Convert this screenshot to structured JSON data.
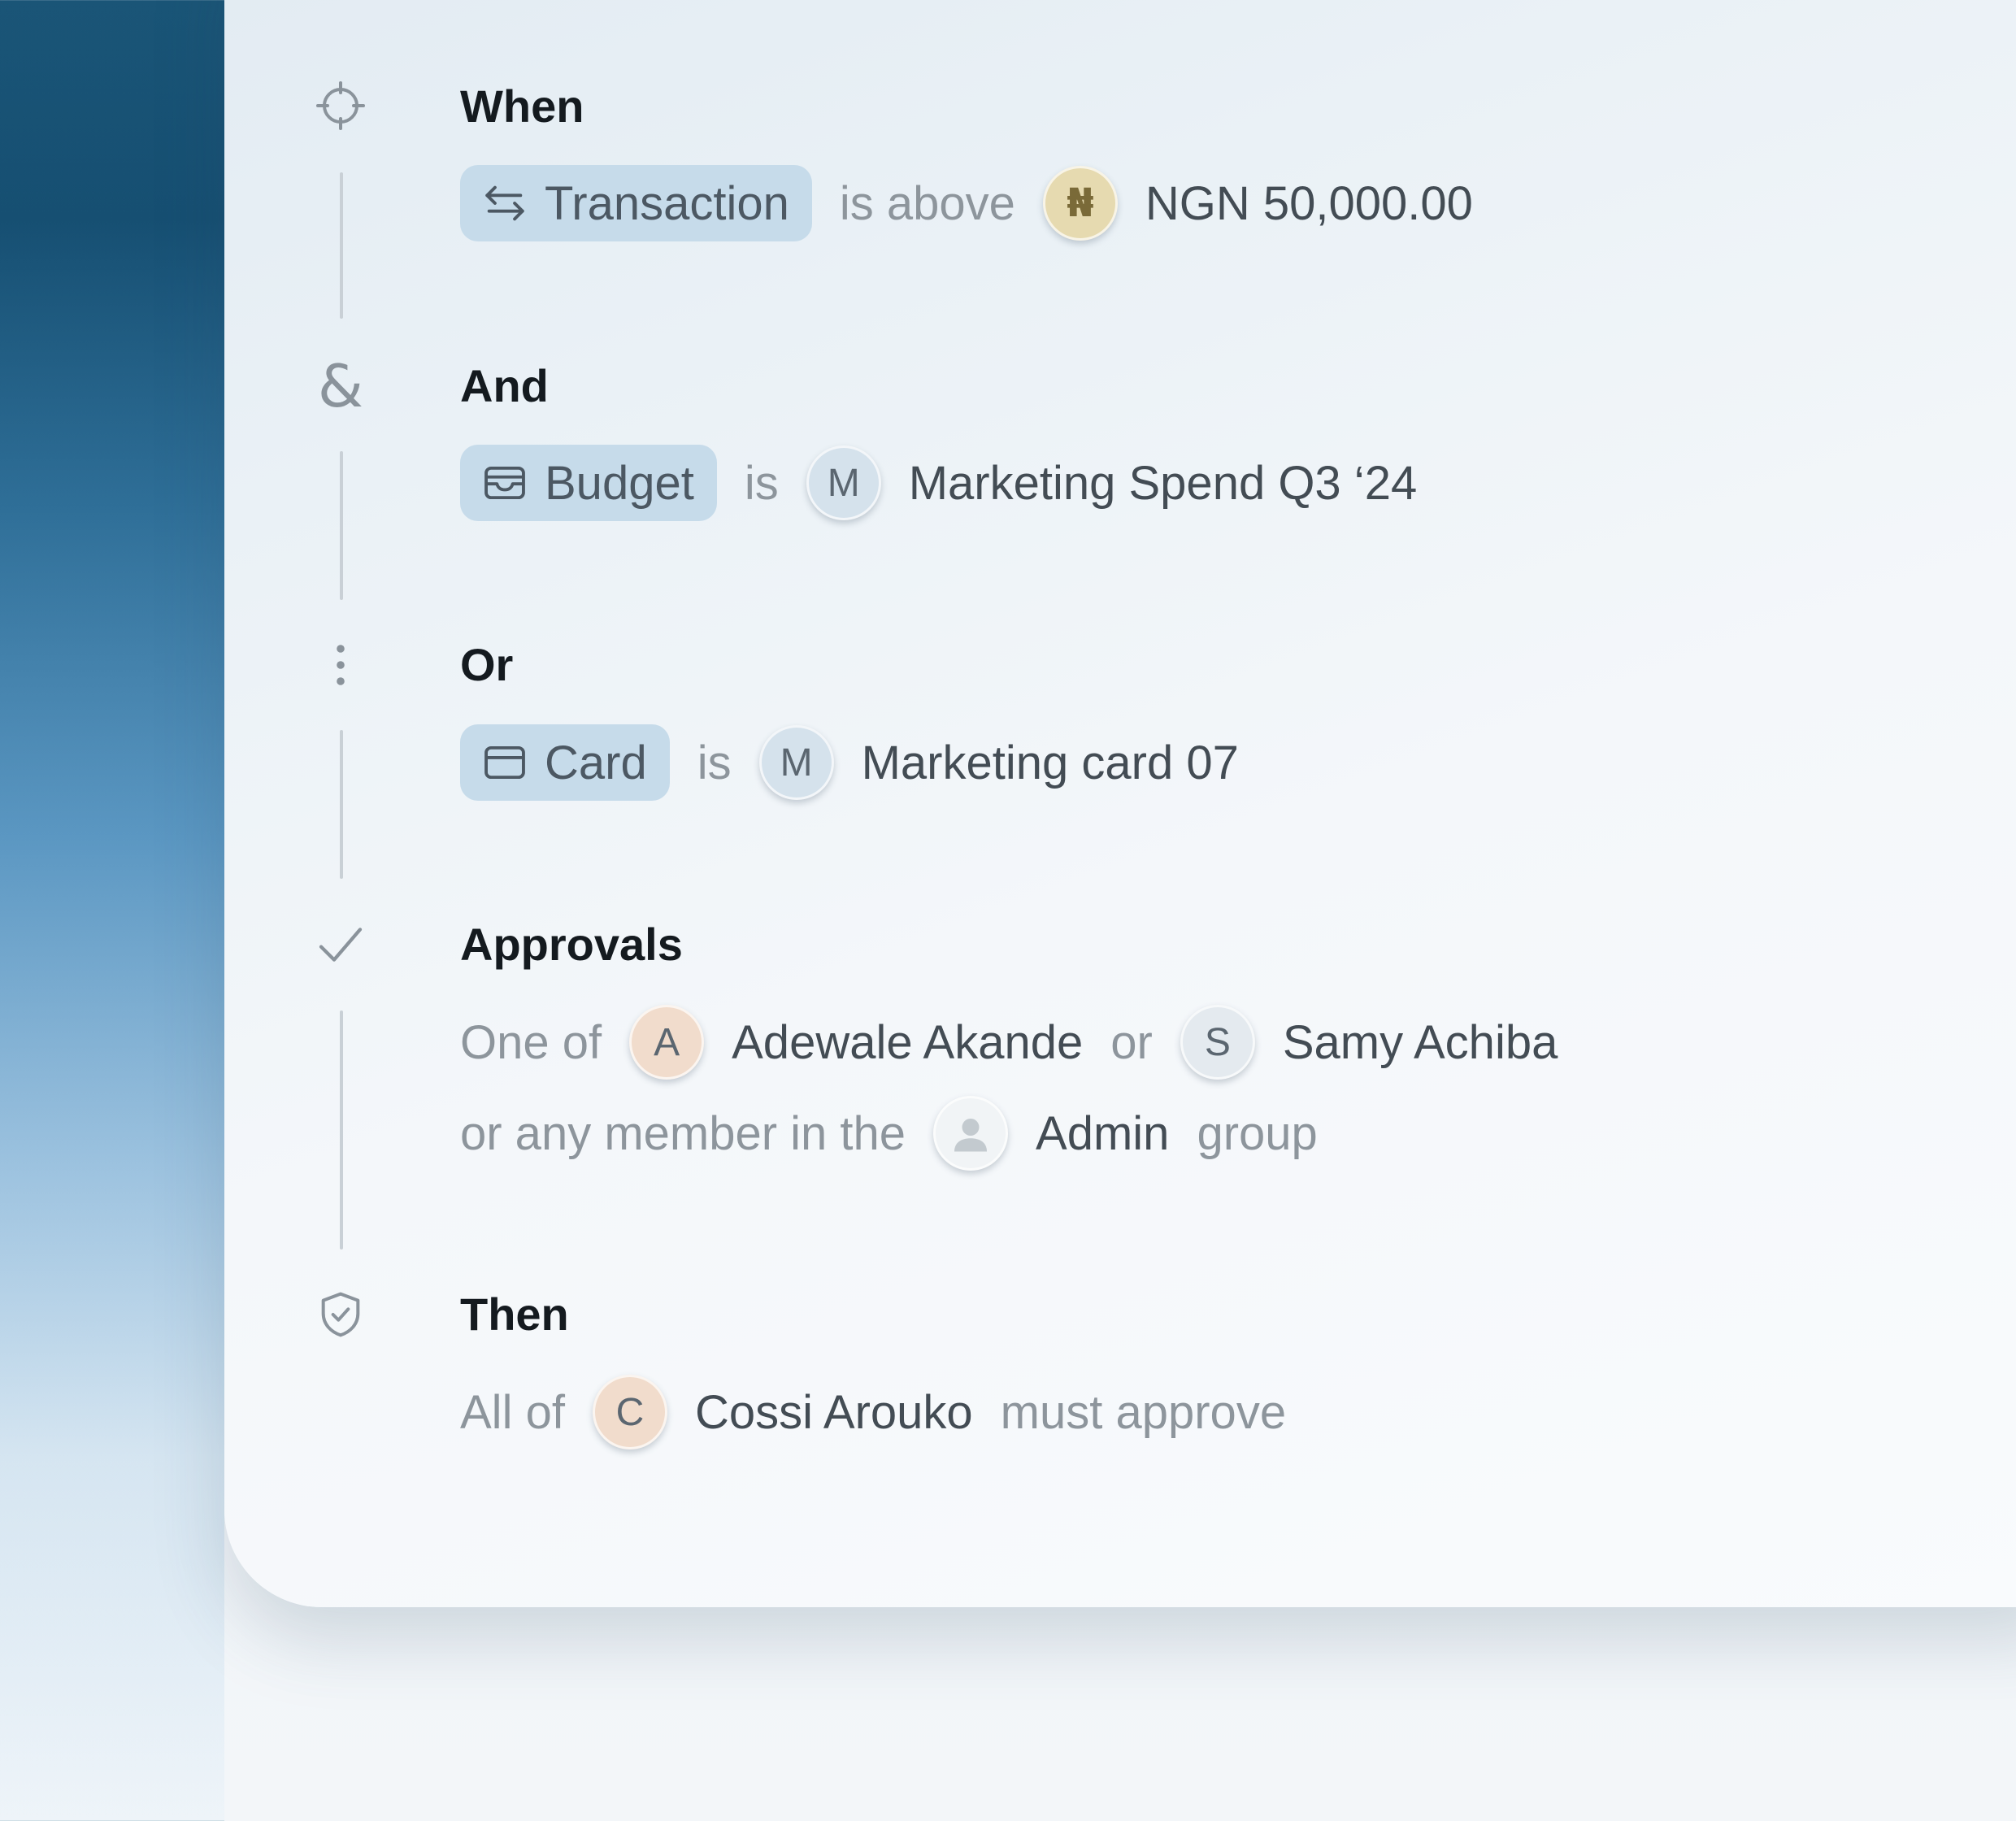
{
  "colors": {
    "chip_bg": "#c6dbea",
    "heading": "#141a1f",
    "muted": "#8d959c",
    "value": "#434c54",
    "naira_avatar": "#e6dab0",
    "peach_avatar": "#f1dccc"
  },
  "when": {
    "icon": "crosshair-icon",
    "title": "When",
    "chip_icon": "swap-arrows-icon",
    "chip_label": "Transaction",
    "operator": "is above",
    "avatar_glyph": "₦",
    "value": "NGN 50,000.00"
  },
  "and": {
    "icon": "ampersand-icon",
    "glyph": "&",
    "title": "And",
    "chip_icon": "wallet-icon",
    "chip_label": "Budget",
    "operator": "is",
    "avatar_initial": "M",
    "value": "Marketing Spend Q3 ‘24"
  },
  "or": {
    "icon": "vertical-dots-icon",
    "title": "Or",
    "chip_icon": "card-icon",
    "chip_label": "Card",
    "operator": "is",
    "avatar_initial": "M",
    "value": "Marketing card 07"
  },
  "approvals": {
    "icon": "check-icon",
    "title": "Approvals",
    "prefix": "One of",
    "approver1": {
      "initial": "A",
      "name": "Adewale Akande"
    },
    "joiner": "or",
    "approver2": {
      "initial": "S",
      "name": "Samy Achiba"
    },
    "group_prefix": "or any member in the",
    "group_avatar_icon": "user-icon",
    "group_name": "Admin",
    "group_suffix": "group"
  },
  "then": {
    "icon": "shield-check-icon",
    "title": "Then",
    "prefix": "All of",
    "approver": {
      "initial": "C",
      "name": "Cossi Arouko"
    },
    "suffix": "must approve"
  }
}
